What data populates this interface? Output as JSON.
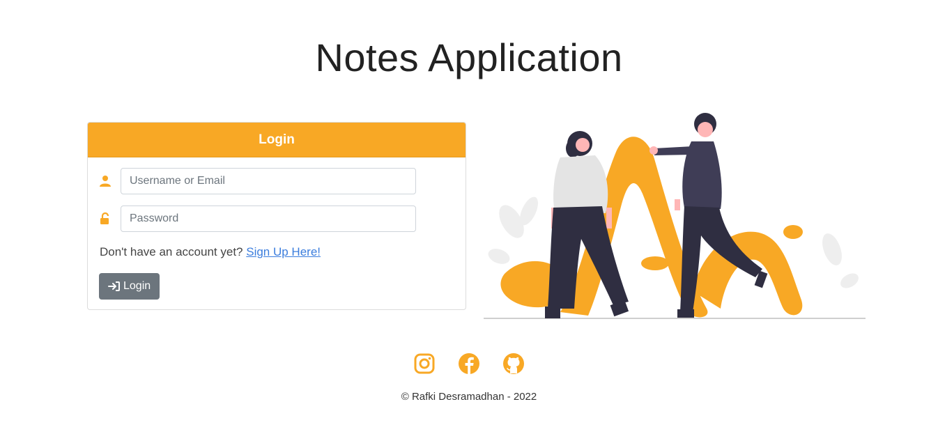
{
  "page": {
    "title": "Notes Application"
  },
  "login": {
    "header": "Login",
    "username_placeholder": "Username or Email",
    "password_placeholder": "Password",
    "signup_prompt": "Don't have an account yet?",
    "signup_link": "Sign Up Here!",
    "button_label": "Login"
  },
  "footer": {
    "copyright": "© Rafki Desramadhan - 2022",
    "socials": [
      "instagram-icon",
      "facebook-icon",
      "github-icon"
    ]
  },
  "colors": {
    "accent": "#f8a825",
    "button": "#6c757d",
    "link": "#3b7ddd"
  }
}
